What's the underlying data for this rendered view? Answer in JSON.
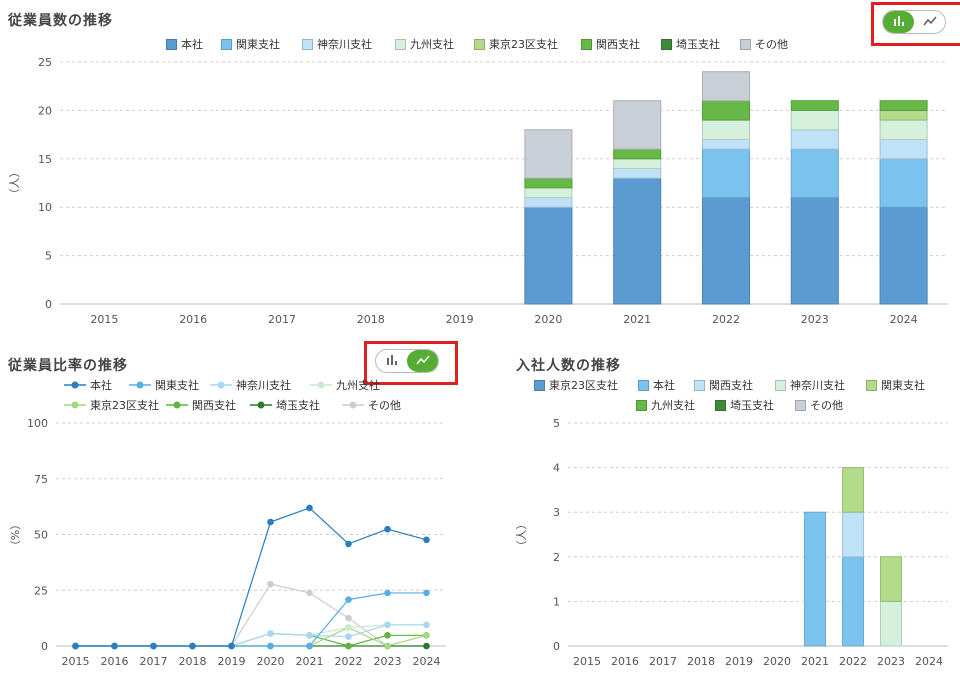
{
  "chart_data": [
    {
      "type": "bar",
      "stacked": true,
      "title": "従業員数の推移",
      "ylabel": "（人）",
      "ylim": [
        0,
        25
      ],
      "yticks": [
        0,
        5,
        10,
        15,
        20,
        25
      ],
      "grid": true,
      "legend": "top-center",
      "categories": [
        "2015",
        "2016",
        "2017",
        "2018",
        "2019",
        "2020",
        "2021",
        "2022",
        "2023",
        "2024"
      ],
      "series": [
        {
          "name": "本社",
          "color": "#5b9bd1",
          "values": [
            0,
            0,
            0,
            0,
            0,
            10,
            13,
            11,
            11,
            10
          ]
        },
        {
          "name": "関東支社",
          "color": "#7bc3ef",
          "values": [
            0,
            0,
            0,
            0,
            0,
            0,
            0,
            5,
            5,
            5
          ]
        },
        {
          "name": "神奈川支社",
          "color": "#c0e2f8",
          "values": [
            0,
            0,
            0,
            0,
            0,
            1,
            1,
            1,
            2,
            2
          ]
        },
        {
          "name": "九州支社",
          "color": "#d5f0dd",
          "values": [
            0,
            0,
            0,
            0,
            0,
            1,
            1,
            2,
            2,
            2
          ]
        },
        {
          "name": "東京23区支社",
          "color": "#b2db8a",
          "values": [
            0,
            0,
            0,
            0,
            0,
            0,
            0,
            0,
            0,
            1
          ]
        },
        {
          "name": "関西支社",
          "color": "#66b847",
          "values": [
            0,
            0,
            0,
            0,
            0,
            1,
            1,
            2,
            1,
            1
          ]
        },
        {
          "name": "埼玉支社",
          "color": "#3e8a3a",
          "values": [
            0,
            0,
            0,
            0,
            0,
            0,
            0,
            0,
            0,
            0
          ]
        },
        {
          "name": "その他",
          "color": "#c9cfd7",
          "values": [
            0,
            0,
            0,
            0,
            0,
            5,
            5,
            3,
            0,
            0
          ]
        }
      ]
    },
    {
      "type": "line",
      "title": "従業員比率の推移",
      "ylabel": "（%）",
      "ylim": [
        0,
        100
      ],
      "yticks": [
        0,
        25,
        50,
        75,
        100
      ],
      "grid": true,
      "legend": "top-left",
      "categories": [
        "2015",
        "2016",
        "2017",
        "2018",
        "2019",
        "2020",
        "2021",
        "2022",
        "2023",
        "2024"
      ],
      "series": [
        {
          "name": "本社",
          "color": "#2b7dc0",
          "values": [
            0,
            0,
            0,
            0,
            0,
            55.6,
            61.9,
            45.8,
            52.4,
            47.6
          ]
        },
        {
          "name": "関東支社",
          "color": "#56aee6",
          "values": [
            0,
            0,
            0,
            0,
            0,
            0,
            0,
            20.8,
            23.8,
            23.8
          ]
        },
        {
          "name": "神奈川支社",
          "color": "#a9d6f3",
          "values": [
            0,
            0,
            0,
            0,
            0,
            5.6,
            4.8,
            4.2,
            9.5,
            9.5
          ]
        },
        {
          "name": "九州支社",
          "color": "#c6ebcf",
          "values": [
            0,
            0,
            0,
            0,
            0,
            5.6,
            4.8,
            8.3,
            9.5,
            9.5
          ]
        },
        {
          "name": "東京23区支社",
          "color": "#a3d97e",
          "values": [
            0,
            0,
            0,
            0,
            0,
            0,
            0,
            8.3,
            0,
            4.8
          ]
        },
        {
          "name": "関西支社",
          "color": "#5fb33f",
          "values": [
            0,
            0,
            0,
            0,
            0,
            5.6,
            4.8,
            0,
            4.8,
            4.8
          ]
        },
        {
          "name": "埼玉支社",
          "color": "#2d7a2d",
          "values": [
            0,
            0,
            0,
            0,
            0,
            0,
            0,
            0,
            0,
            0
          ]
        },
        {
          "name": "その他",
          "color": "#cdcdcd",
          "values": [
            0,
            0,
            0,
            0,
            0,
            27.8,
            23.8,
            12.5,
            0,
            0
          ]
        }
      ]
    },
    {
      "type": "bar",
      "stacked": true,
      "title": "入社人数の推移",
      "ylabel": "（人）",
      "ylim": [
        0,
        5
      ],
      "yticks": [
        0,
        1,
        2,
        3,
        4,
        5
      ],
      "grid": true,
      "legend": "top-center",
      "categories": [
        "2015",
        "2016",
        "2017",
        "2018",
        "2019",
        "2020",
        "2021",
        "2022",
        "2023",
        "2024"
      ],
      "series": [
        {
          "name": "東京23区支社",
          "color": "#5b9bd1",
          "values": [
            0,
            0,
            0,
            0,
            0,
            0,
            0,
            0,
            0,
            0
          ]
        },
        {
          "name": "本社",
          "color": "#7bc3ef",
          "values": [
            0,
            0,
            0,
            0,
            0,
            0,
            3,
            2,
            0,
            0
          ]
        },
        {
          "name": "関西支社",
          "color": "#c0e2f8",
          "values": [
            0,
            0,
            0,
            0,
            0,
            0,
            0,
            1,
            0,
            0
          ]
        },
        {
          "name": "神奈川支社",
          "color": "#d5f0dd",
          "values": [
            0,
            0,
            0,
            0,
            0,
            0,
            0,
            0,
            1,
            0
          ]
        },
        {
          "name": "関東支社",
          "color": "#b2db8a",
          "values": [
            0,
            0,
            0,
            0,
            0,
            0,
            0,
            1,
            1,
            0
          ]
        },
        {
          "name": "九州支社",
          "color": "#66b847",
          "values": [
            0,
            0,
            0,
            0,
            0,
            0,
            0,
            0,
            0,
            0
          ]
        },
        {
          "name": "埼玉支社",
          "color": "#3e8a3a",
          "values": [
            0,
            0,
            0,
            0,
            0,
            0,
            0,
            0,
            0,
            0
          ]
        },
        {
          "name": "その他",
          "color": "#c9cfd7",
          "values": [
            0,
            0,
            0,
            0,
            0,
            0,
            0,
            0,
            0,
            0
          ]
        }
      ]
    }
  ],
  "toggles": {
    "employees": {
      "active": "bar",
      "bar_icon": "bar-chart-icon",
      "line_icon": "line-chart-icon"
    },
    "ratio": {
      "active": "line",
      "bar_icon": "bar-chart-icon",
      "line_icon": "line-chart-icon"
    }
  }
}
